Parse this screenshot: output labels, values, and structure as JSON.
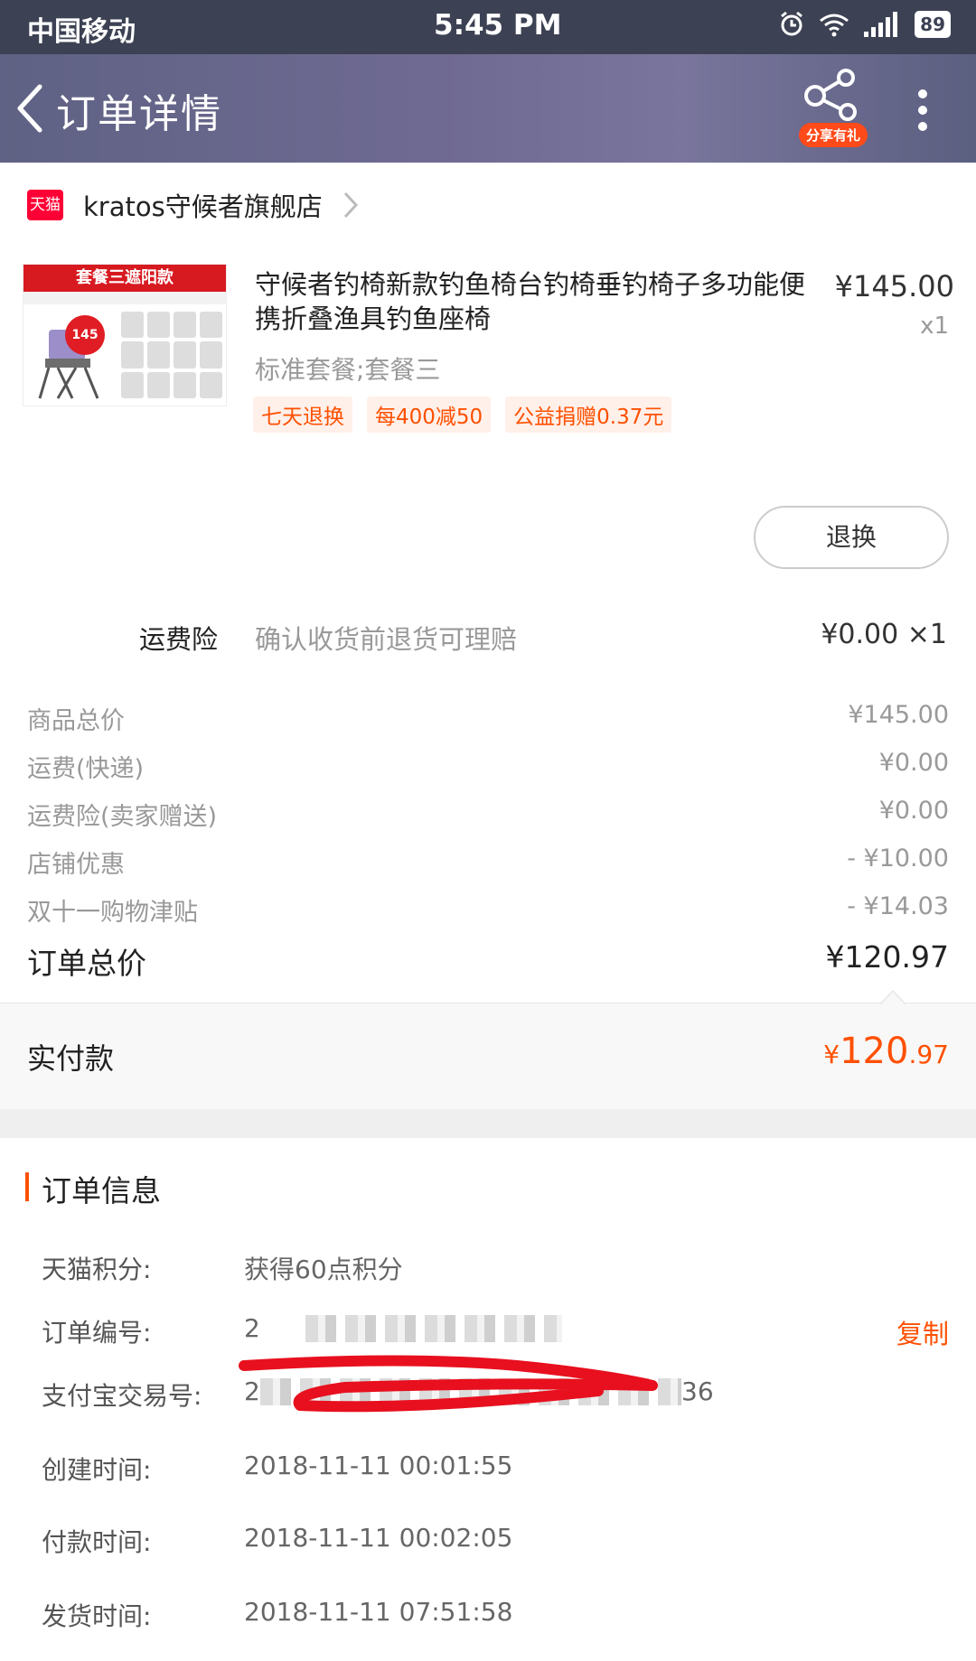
{
  "status_bar": {
    "carrier": "中国移动",
    "time": "5:45 PM",
    "battery": "89"
  },
  "nav": {
    "title": "订单详情",
    "share_badge": "分享有礼"
  },
  "shop": {
    "platform_badge": "天猫",
    "name": "kratos守候者旗舰店"
  },
  "product": {
    "image_banner": "套餐三遮阳款",
    "image_price_tag": "145",
    "title": "守候者钓椅新款钓鱼椅台钓椅垂钓椅子多功能便携折叠渔具钓鱼座椅",
    "price": "¥145.00",
    "quantity": "x1",
    "sku": "标准套餐;套餐三",
    "tags": [
      "七天退换",
      "每400减50",
      "公益捐赠0.37元"
    ]
  },
  "refund_button": "退换",
  "shipping_insurance": {
    "label": "运费险",
    "description": "确认收货前退货可理赔",
    "value": "¥0.00 ×1"
  },
  "price_breakdown": [
    {
      "label": "商品总价",
      "value": "¥145.00"
    },
    {
      "label": "运费(快递)",
      "value": "¥0.00"
    },
    {
      "label": "运费险(卖家赠送)",
      "value": "¥0.00"
    },
    {
      "label": "店铺优惠",
      "value": "- ¥10.00"
    },
    {
      "label": "双十一购物津贴",
      "value": "- ¥14.03"
    }
  ],
  "order_total": {
    "label": "订单总价",
    "value": "¥120.97"
  },
  "paid": {
    "label": "实付款",
    "currency": "¥",
    "integer": "120",
    "decimal": ".97"
  },
  "order_info": {
    "title": "订单信息",
    "rows": [
      {
        "label": "天猫积分:",
        "value": "获得60点积分"
      },
      {
        "label": "订单编号:",
        "value": "2",
        "action": "复制"
      },
      {
        "label": "支付宝交易号:",
        "value": "2",
        "value_tail": "36"
      },
      {
        "label": "创建时间:",
        "value": "2018-11-11 00:01:55"
      },
      {
        "label": "付款时间:",
        "value": "2018-11-11 00:02:05"
      },
      {
        "label": "发货时间:",
        "value": "2018-11-11 07:51:58"
      }
    ]
  },
  "colors": {
    "accent": "#ff5000",
    "nav_bg": "#6f6a92",
    "status_bg": "#3c4153",
    "tmall_red": "#ff0036"
  },
  "icons": [
    "back-arrow-icon",
    "share-icon",
    "more-vertical-icon",
    "chevron-right-icon",
    "alarm-icon",
    "wifi-icon",
    "signal-icon",
    "battery-icon"
  ]
}
